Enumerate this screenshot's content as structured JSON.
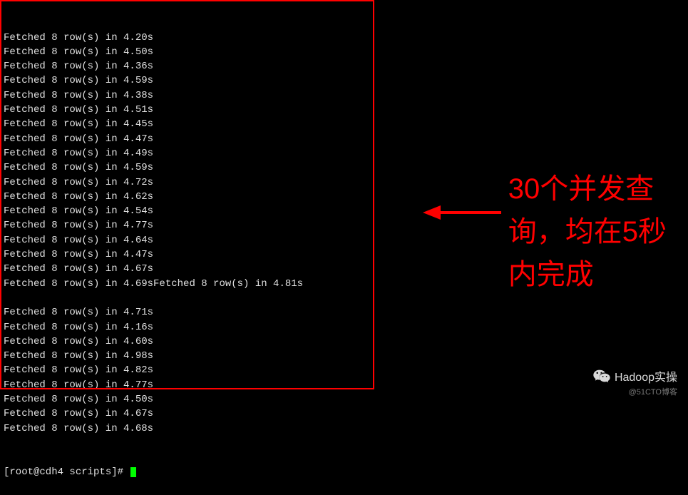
{
  "terminal": {
    "lines": [
      "Fetched 8 row(s) in 4.20s",
      "Fetched 8 row(s) in 4.50s",
      "Fetched 8 row(s) in 4.36s",
      "Fetched 8 row(s) in 4.59s",
      "Fetched 8 row(s) in 4.38s",
      "Fetched 8 row(s) in 4.51s",
      "Fetched 8 row(s) in 4.45s",
      "Fetched 8 row(s) in 4.47s",
      "Fetched 8 row(s) in 4.49s",
      "Fetched 8 row(s) in 4.59s",
      "Fetched 8 row(s) in 4.72s",
      "Fetched 8 row(s) in 4.62s",
      "Fetched 8 row(s) in 4.54s",
      "Fetched 8 row(s) in 4.77s",
      "Fetched 8 row(s) in 4.64s",
      "Fetched 8 row(s) in 4.47s",
      "Fetched 8 row(s) in 4.67s",
      "Fetched 8 row(s) in 4.69sFetched 8 row(s) in 4.81s",
      "",
      "Fetched 8 row(s) in 4.71s",
      "Fetched 8 row(s) in 4.16s",
      "Fetched 8 row(s) in 4.60s",
      "Fetched 8 row(s) in 4.98s",
      "Fetched 8 row(s) in 4.82s",
      "Fetched 8 row(s) in 4.77s",
      "Fetched 8 row(s) in 4.50s",
      "Fetched 8 row(s) in 4.67s",
      "Fetched 8 row(s) in 4.68s"
    ],
    "prompt": "[root@cdh4 scripts]# "
  },
  "annotation": {
    "text": "30个并发查\n询，均在5秒\n内完成"
  },
  "watermark": {
    "brand": "Hadoop实操",
    "sub": "@51CTO博客"
  }
}
